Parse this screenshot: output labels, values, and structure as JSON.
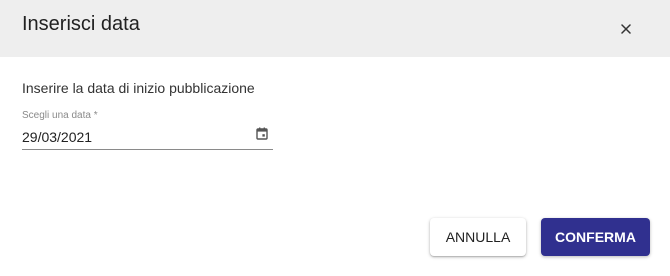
{
  "dialog": {
    "title": "Inserisci data",
    "close_icon": "close-icon"
  },
  "content": {
    "instruction": "Inserire la data di inizio pubblicazione",
    "date_field": {
      "label": "Scegli una data *",
      "value": "29/03/2021",
      "icon": "calendar-icon"
    }
  },
  "actions": {
    "cancel_label": "ANNULLA",
    "confirm_label": "CONFERMA"
  },
  "colors": {
    "header_bg": "#eeeeee",
    "confirm_bg": "#30308f",
    "confirm_text": "#ffffff"
  }
}
